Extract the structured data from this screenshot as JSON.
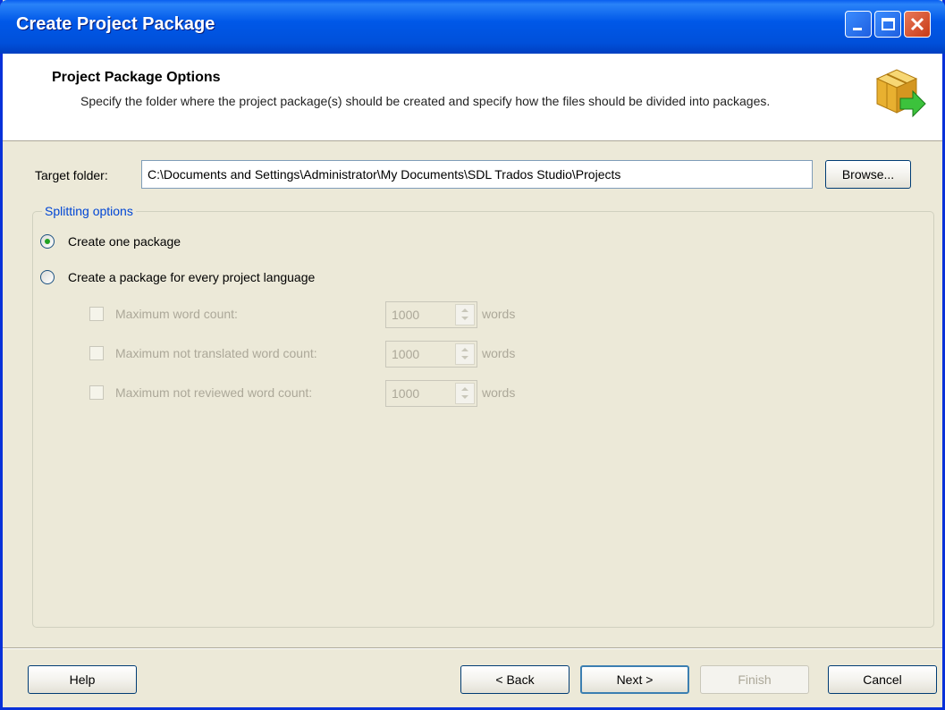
{
  "window": {
    "title": "Create Project Package"
  },
  "header": {
    "title": "Project Package Options",
    "description": "Specify the folder where the project package(s) should be created and specify how the files should be divided into packages.",
    "icon": "package-arrow-icon"
  },
  "target": {
    "label": "Target folder:",
    "value": "C:\\Documents and Settings\\Administrator\\My Documents\\SDL Trados Studio\\Projects",
    "browse_label": "Browse..."
  },
  "splitting": {
    "legend": "Splitting options",
    "options": [
      {
        "label": "Create one package",
        "selected": true
      },
      {
        "label": "Create a package for every project language",
        "selected": false
      }
    ],
    "limits": [
      {
        "label": "Maximum word count:",
        "value": "1000",
        "unit": "words",
        "checked": false,
        "enabled": false
      },
      {
        "label": "Maximum not translated word count:",
        "value": "1000",
        "unit": "words",
        "checked": false,
        "enabled": false
      },
      {
        "label": "Maximum not reviewed word count:",
        "value": "1000",
        "unit": "words",
        "checked": false,
        "enabled": false
      }
    ]
  },
  "footer": {
    "help": "Help",
    "back": "< Back",
    "next": "Next >",
    "finish": "Finish",
    "cancel": "Cancel"
  },
  "colors": {
    "titlebar": "#0058e8",
    "dialog_bg": "#ece9d8",
    "group_legend": "#0046d5",
    "disabled_text": "#aca899"
  }
}
